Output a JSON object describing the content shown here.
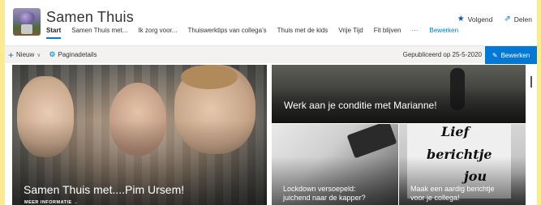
{
  "header": {
    "site_title": "Samen Thuis",
    "nav": [
      "Start",
      "Samen Thuis met...",
      "Ik zorg voor...",
      "Thuiswerktips van collega's",
      "Thuis met de kids",
      "Vrije Tijd",
      "Fit blijven"
    ],
    "nav_more": "···",
    "nav_edit": "Bewerken",
    "follow_label": "Volgend",
    "share_label": "Delen"
  },
  "command_bar": {
    "new_label": "Nieuw",
    "page_details_label": "Paginadetails",
    "published_text": "Gepubliceerd op 25-5-2020",
    "edit_label": "Bewerken"
  },
  "hero": {
    "main": {
      "title": "Samen Thuis met....Pim Ursem!",
      "more_info": "MEER INFORMATIE →"
    },
    "fitness": {
      "title": "Werk aan je conditie met Marianne!"
    },
    "hair": {
      "title_line1": "Lockdown versoepeld:",
      "title_line2": "juichend naar de kapper?"
    },
    "note": {
      "image_text": [
        "Lief",
        "berichtje",
        "jou"
      ],
      "title_line1": "Maak een aardig berichtje",
      "title_line2": "voor je collega!"
    }
  },
  "colors": {
    "accent": "#0078d4",
    "background": "#fdec8f"
  }
}
